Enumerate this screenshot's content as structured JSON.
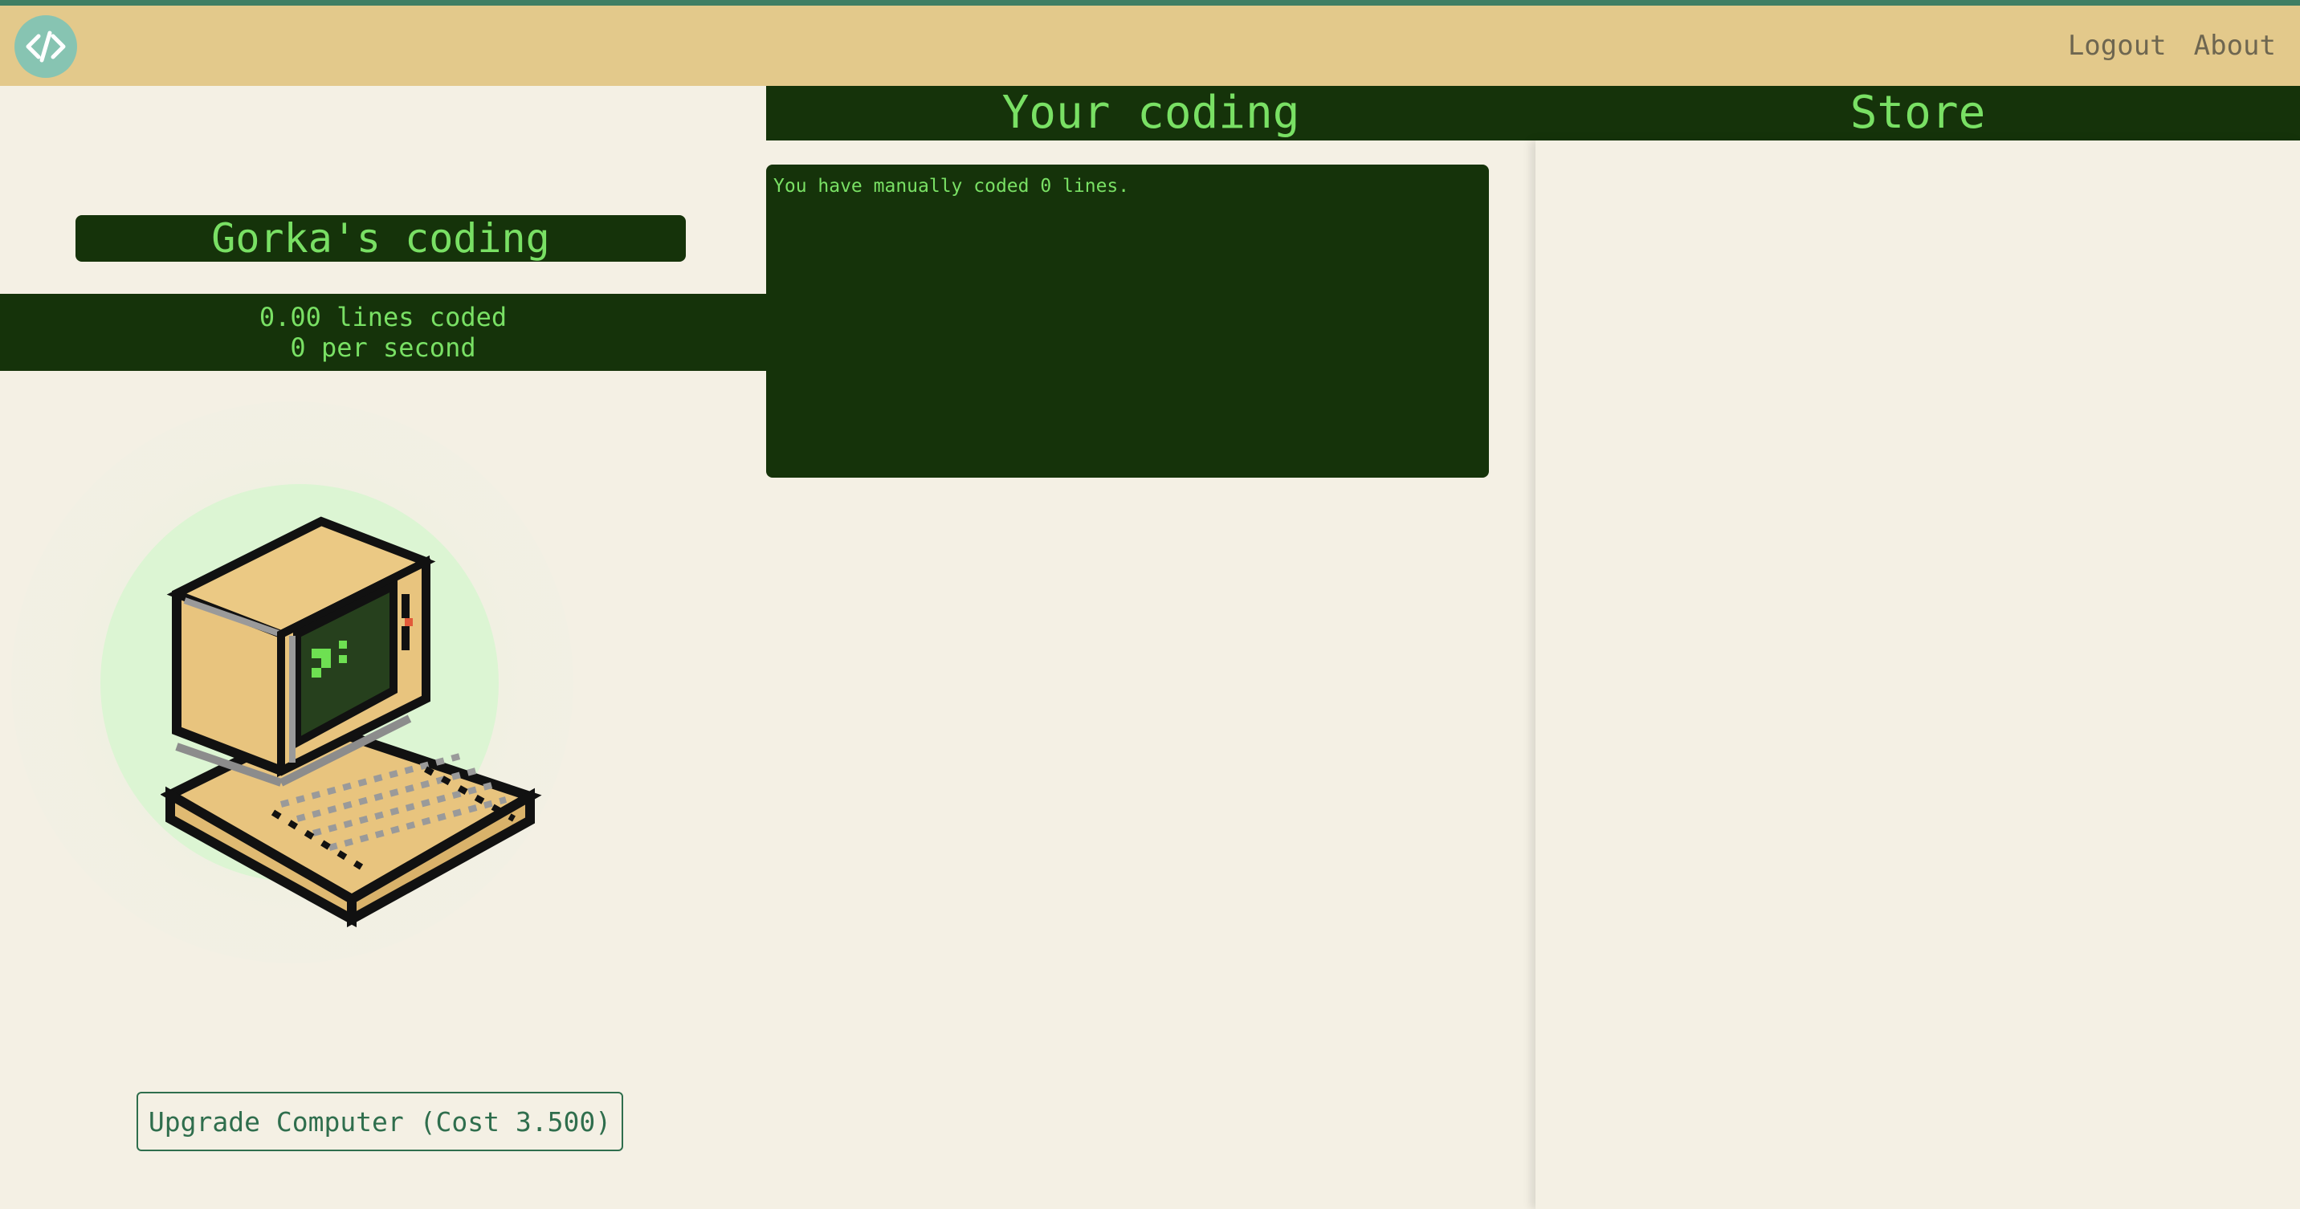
{
  "navbar": {
    "logo_icon": "code-brackets-icon",
    "links": [
      {
        "label": "Logout"
      },
      {
        "label": "About"
      }
    ]
  },
  "player": {
    "title": "Gorka's coding",
    "lines_coded": "0.00 lines coded",
    "per_second": "0 per second",
    "clicker_icon": "retro-computer-icon"
  },
  "upgrade": {
    "label": "Upgrade Computer (Cost 3.500)"
  },
  "coding": {
    "header": "Your coding",
    "log": "You have manually coded 0 lines."
  },
  "store": {
    "header": "Store"
  },
  "colors": {
    "navbar": "#e3c98b",
    "accent_top": "#3f7e64",
    "panel_dark": "#15330a",
    "text_green": "#79e064",
    "background": "#f4f0e4",
    "button_border": "#2f6e4d"
  }
}
